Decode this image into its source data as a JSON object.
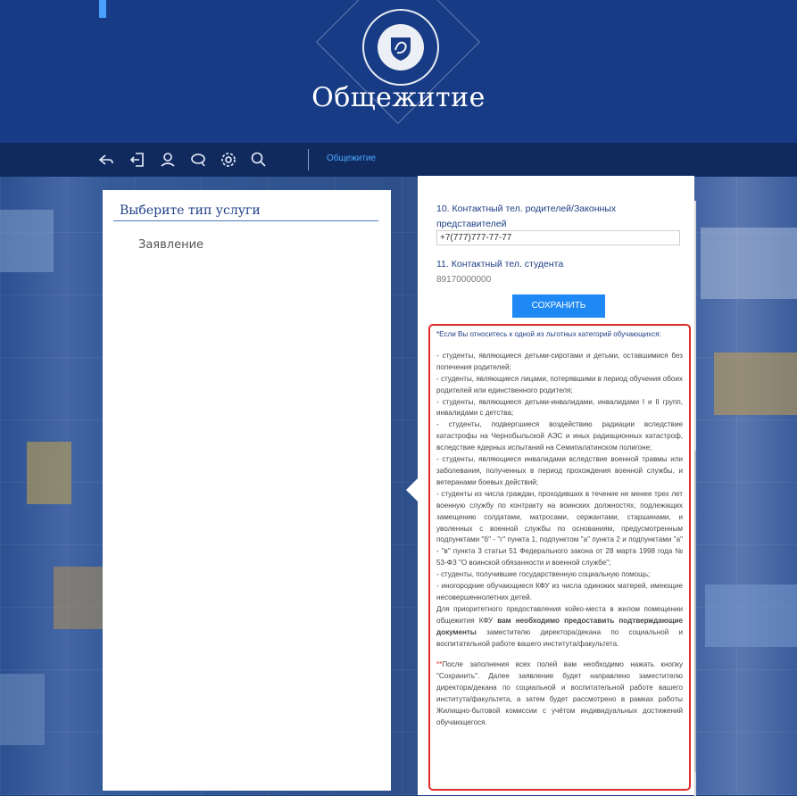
{
  "header": {
    "title": "Общежитие"
  },
  "toolbar": {
    "breadcrumb": "Общежитие",
    "icons": [
      "back-icon",
      "logout-icon",
      "user-icon",
      "messages-icon",
      "settings-icon",
      "search-icon"
    ]
  },
  "left_panel": {
    "title": "Выберите тип услуги",
    "items": [
      "Заявление"
    ]
  },
  "form": {
    "parents_phone_label": "10. Контактный тел. родителей/Законных представителей",
    "parents_phone_value": "+7(777)777-77-77",
    "student_phone_label": "11. Контактный тел. студента",
    "student_phone_value": "89170000000",
    "save_label": "СОХРАНИТЬ"
  },
  "notice": {
    "intro": "*Если Вы относитесь к одной из льготных категорий обучающихся:",
    "items": [
      "- студенты, являющиеся детьми-сиротами и детьми, оставшимися без попечения родителей;",
      "- студенты, являющиеся лицами, потерявшими в период обучения обоих родителей или единственного родителя;",
      "- студенты, являющиеся детьми-инвалидами, инвалидами I и II групп, инвалидами с детства;",
      "- студенты, подвергшиеся воздействию радиации вследствие катастрофы на Чернобыльской АЭС и иных радиационных катастроф, вследствие ядерных испытаний на Семипалатинском полигоне;",
      "- студенты, являющиеся инвалидами вследствие военной травмы или заболевания, полученных в период прохождения военной службы, и ветеранами боевых действий;",
      "- студенты из числа граждан, проходивших в течение не менее трех лет военную службу по контракту на воинских должностях, подлежащих замещению солдатами, матросами, сержантами, старшинами, и уволенных с военной службы по основаниям, предусмотренным подпунктами \"б\" - \"г\" пункта 1, подпунктом \"а\" пункта 2 и подпунктами \"а\" - \"в\" пункта 3 статьи 51 Федерального закона от 28 марта 1998 года № 53-ФЗ \"О воинской обязанности и военной службе\";",
      "- студенты, получившие государственную социальную помощь;",
      "- иногородние обучающиеся КФУ из числа одиноких матерей, имеющие несовершеннолетних детей."
    ],
    "outro_before": "Для приоритетного предоставления койко-места в жилом помещении общежития КФУ ",
    "outro_bold": "вам необходимо предоставить подтверждающие документы",
    "outro_after": " заместителю директора/декана по социальной и воспитательной работе вашего института/факультета.",
    "footnote_star": "**",
    "footnote_text": "После заполнения всех полей вам необходимо нажать кнопку \"Сохранить\". Далее заявление будет направлено заместителю директора/декана по социальной и воспитательной работе вашего института/факультета, а затем будет рассмотрено в рамках работы Жилищно-бытовой комиссии с учётом индивидуальных достижений обучающегося."
  },
  "colors": {
    "header_bg": "#173b85",
    "toolbar_bg": "#102a5e",
    "accent": "#1e88f5",
    "highlight_border": "#e02b2b"
  }
}
